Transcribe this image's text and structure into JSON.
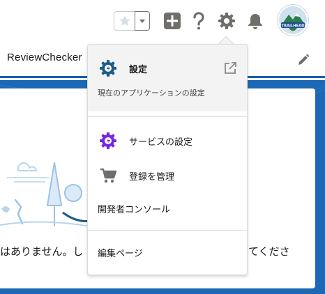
{
  "header": {
    "favorites_icon": "star-icon",
    "favorites_menu_icon": "chevron-down-icon",
    "add_icon": "plus-icon",
    "help_icon": "question-icon",
    "setup_icon": "gear-icon",
    "notifications_icon": "bell-icon",
    "avatar_text": "TRAILHEAD"
  },
  "nav": {
    "app_name": "ReviewChecker",
    "edit_icon": "pencil-icon"
  },
  "card": {
    "text_left": "はありません。し",
    "text_right": "てくださ"
  },
  "setup_menu": {
    "items": [
      {
        "label": "設定",
        "sublabel": "現在のアプリケーションの設定",
        "icon": "setup-gear-icon",
        "external_icon": "external-link-icon"
      },
      {
        "label": "サービスの設定",
        "icon": "service-setup-icon"
      },
      {
        "label": "登録を管理",
        "icon": "cart-icon"
      },
      {
        "label": "開発者コンソール"
      },
      {
        "label": "編集ページ"
      }
    ]
  },
  "colors": {
    "brand_blue": "#1d68b4",
    "setup_blue": "#1b5b8a",
    "service_purple": "#7526e3",
    "icon_gray": "#706e6b"
  }
}
